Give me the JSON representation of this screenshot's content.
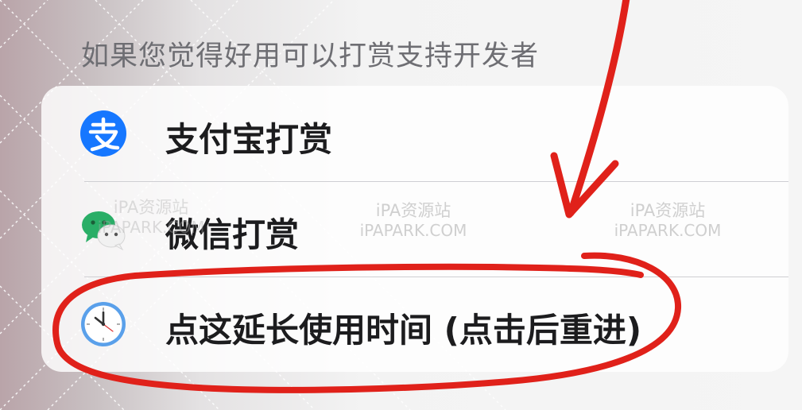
{
  "section_header": "如果您觉得好用可以打赏支持开发者",
  "rows": [
    {
      "label": "支付宝打赏",
      "icon": "alipay-icon",
      "icon_color": "#1677ff"
    },
    {
      "label": "微信打赏",
      "icon": "wechat-icon",
      "icon_color": "#2aae67"
    },
    {
      "label": "点这延长使用时间 (点击后重进)",
      "icon": "clock-icon",
      "icon_color": "#4a90e2"
    }
  ],
  "watermark": {
    "line1": "iPA资源站",
    "line2": "iPAPARK.COM"
  },
  "colors": {
    "annotation_red": "#e0211a",
    "header_text": "#6e6e73",
    "row_text": "#1c1c1e"
  }
}
